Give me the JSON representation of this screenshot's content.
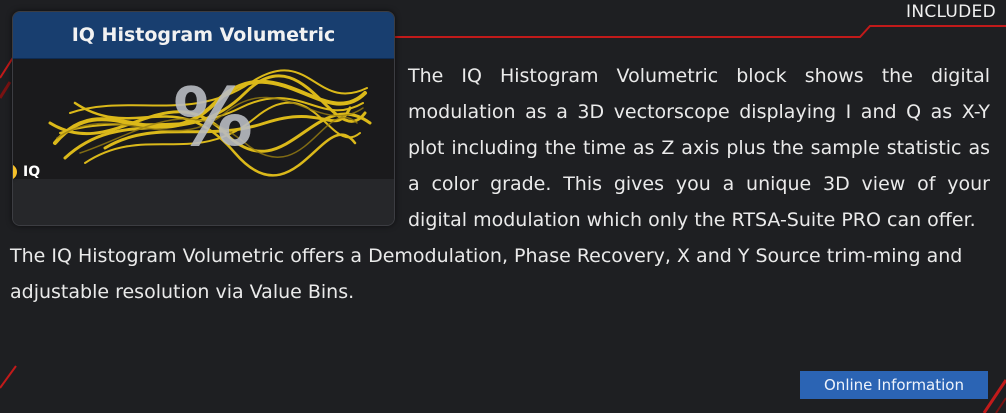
{
  "status": {
    "label": "INCLUDED"
  },
  "block": {
    "title": "IQ Histogram Volumetric",
    "symbol": "%",
    "input_port": "IQ",
    "colors": {
      "header": "#183e6f",
      "port": "#f5c02a",
      "traces": "#e6c21a"
    }
  },
  "description": {
    "paragraph1": "The IQ Histogram Volumetric block shows the digital modulation as a 3D vectorscope displaying I and Q as X-Y plot including the time as Z axis plus the sample statistic as a color grade. This gives you a unique 3D view of your digital modulation which only the RTSA-Suite PRO can offer.",
    "paragraph2": "The IQ Histogram Volumetric offers a Demodulation, Phase Recovery, X and Y Source trim-ming and adjustable resolution via Value Bins."
  },
  "actions": {
    "online_info": "Online Information"
  },
  "theme": {
    "background": "#1e1f22",
    "accent_red": "#c21a1a",
    "button": "#2b64b4"
  }
}
